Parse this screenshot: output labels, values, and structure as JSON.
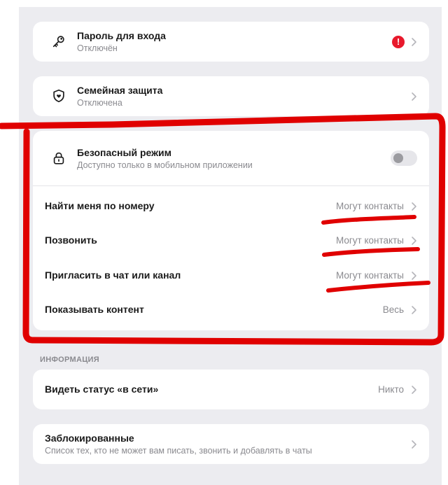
{
  "cards": {
    "password": {
      "title": "Пароль для входа",
      "subtitle": "Отключён",
      "alert": "!"
    },
    "family": {
      "title": "Семейная защита",
      "subtitle": "Отключена"
    },
    "privacy": {
      "safe_mode": {
        "title": "Безопасный режим",
        "subtitle": "Доступно только в мобильном приложении",
        "enabled": false
      },
      "rows": [
        {
          "label": "Найти меня по номеру",
          "value": "Могут контакты"
        },
        {
          "label": "Позвонить",
          "value": "Могут контакты"
        },
        {
          "label": "Пригласить в чат или канал",
          "value": "Могут контакты"
        },
        {
          "label": "Показывать контент",
          "value": "Весь"
        }
      ]
    }
  },
  "info_section": {
    "label": "ИНФОРМАЦИЯ",
    "online_status": {
      "label": "Видеть статус «в сети»",
      "value": "Никто"
    },
    "blocked": {
      "title": "Заблокированные",
      "subtitle": "Список тех, кто не может вам писать, звонить и добавлять в чаты"
    }
  },
  "icons": [
    "key-icon",
    "shield-heart-icon",
    "lock-icon",
    "chevron-right-icon",
    "alert-icon"
  ],
  "colors": {
    "panel_bg": "#ececf0",
    "alert": "#e8192c",
    "annotation": "#e00000"
  }
}
